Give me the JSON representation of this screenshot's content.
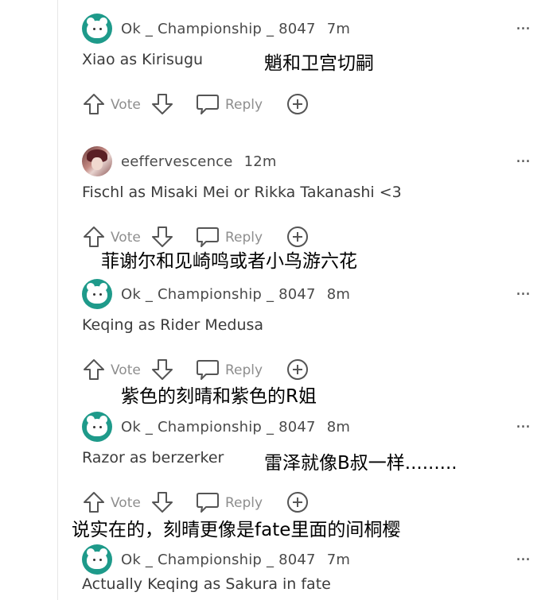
{
  "comments": [
    {
      "username": "Ok _ Championship _ 8047",
      "time": "7m",
      "text": "Xiao as Kirisugu",
      "avatar": "green-cat-avatar",
      "vote": "Vote",
      "reply": "Reply",
      "more": "..."
    },
    {
      "username": "eeffervescence",
      "time": "12m",
      "text": "Fischl as Misaki Mei or Rikka Takanashi <3",
      "avatar": "anime-photo-avatar",
      "vote": "Vote",
      "reply": "Reply",
      "more": "..."
    },
    {
      "username": "Ok _ Championship _ 8047",
      "time": "8m",
      "text": "Keqing as Rider Medusa",
      "avatar": "green-cat-avatar",
      "vote": "Vote",
      "reply": "Reply",
      "more": "..."
    },
    {
      "username": "Ok _ Championship _ 8047",
      "time": "8m",
      "text": "Razor as berzerker",
      "avatar": "green-cat-avatar",
      "vote": "Vote",
      "reply": "Reply",
      "more": "..."
    },
    {
      "username": "Ok _ Championship _ 8047",
      "time": "7m",
      "text": "Actually Keqing as Sakura in fate",
      "avatar": "green-cat-avatar",
      "more": "..."
    }
  ],
  "translations": [
    "魈和卫宫切嗣",
    "菲谢尔和见崎鸣或者小鸟游六花",
    "紫色的刻晴和紫色的R姐",
    "雷泽就像B叔一样.........",
    "说实在的，刻晴更像是fate里面的间桐樱"
  ]
}
